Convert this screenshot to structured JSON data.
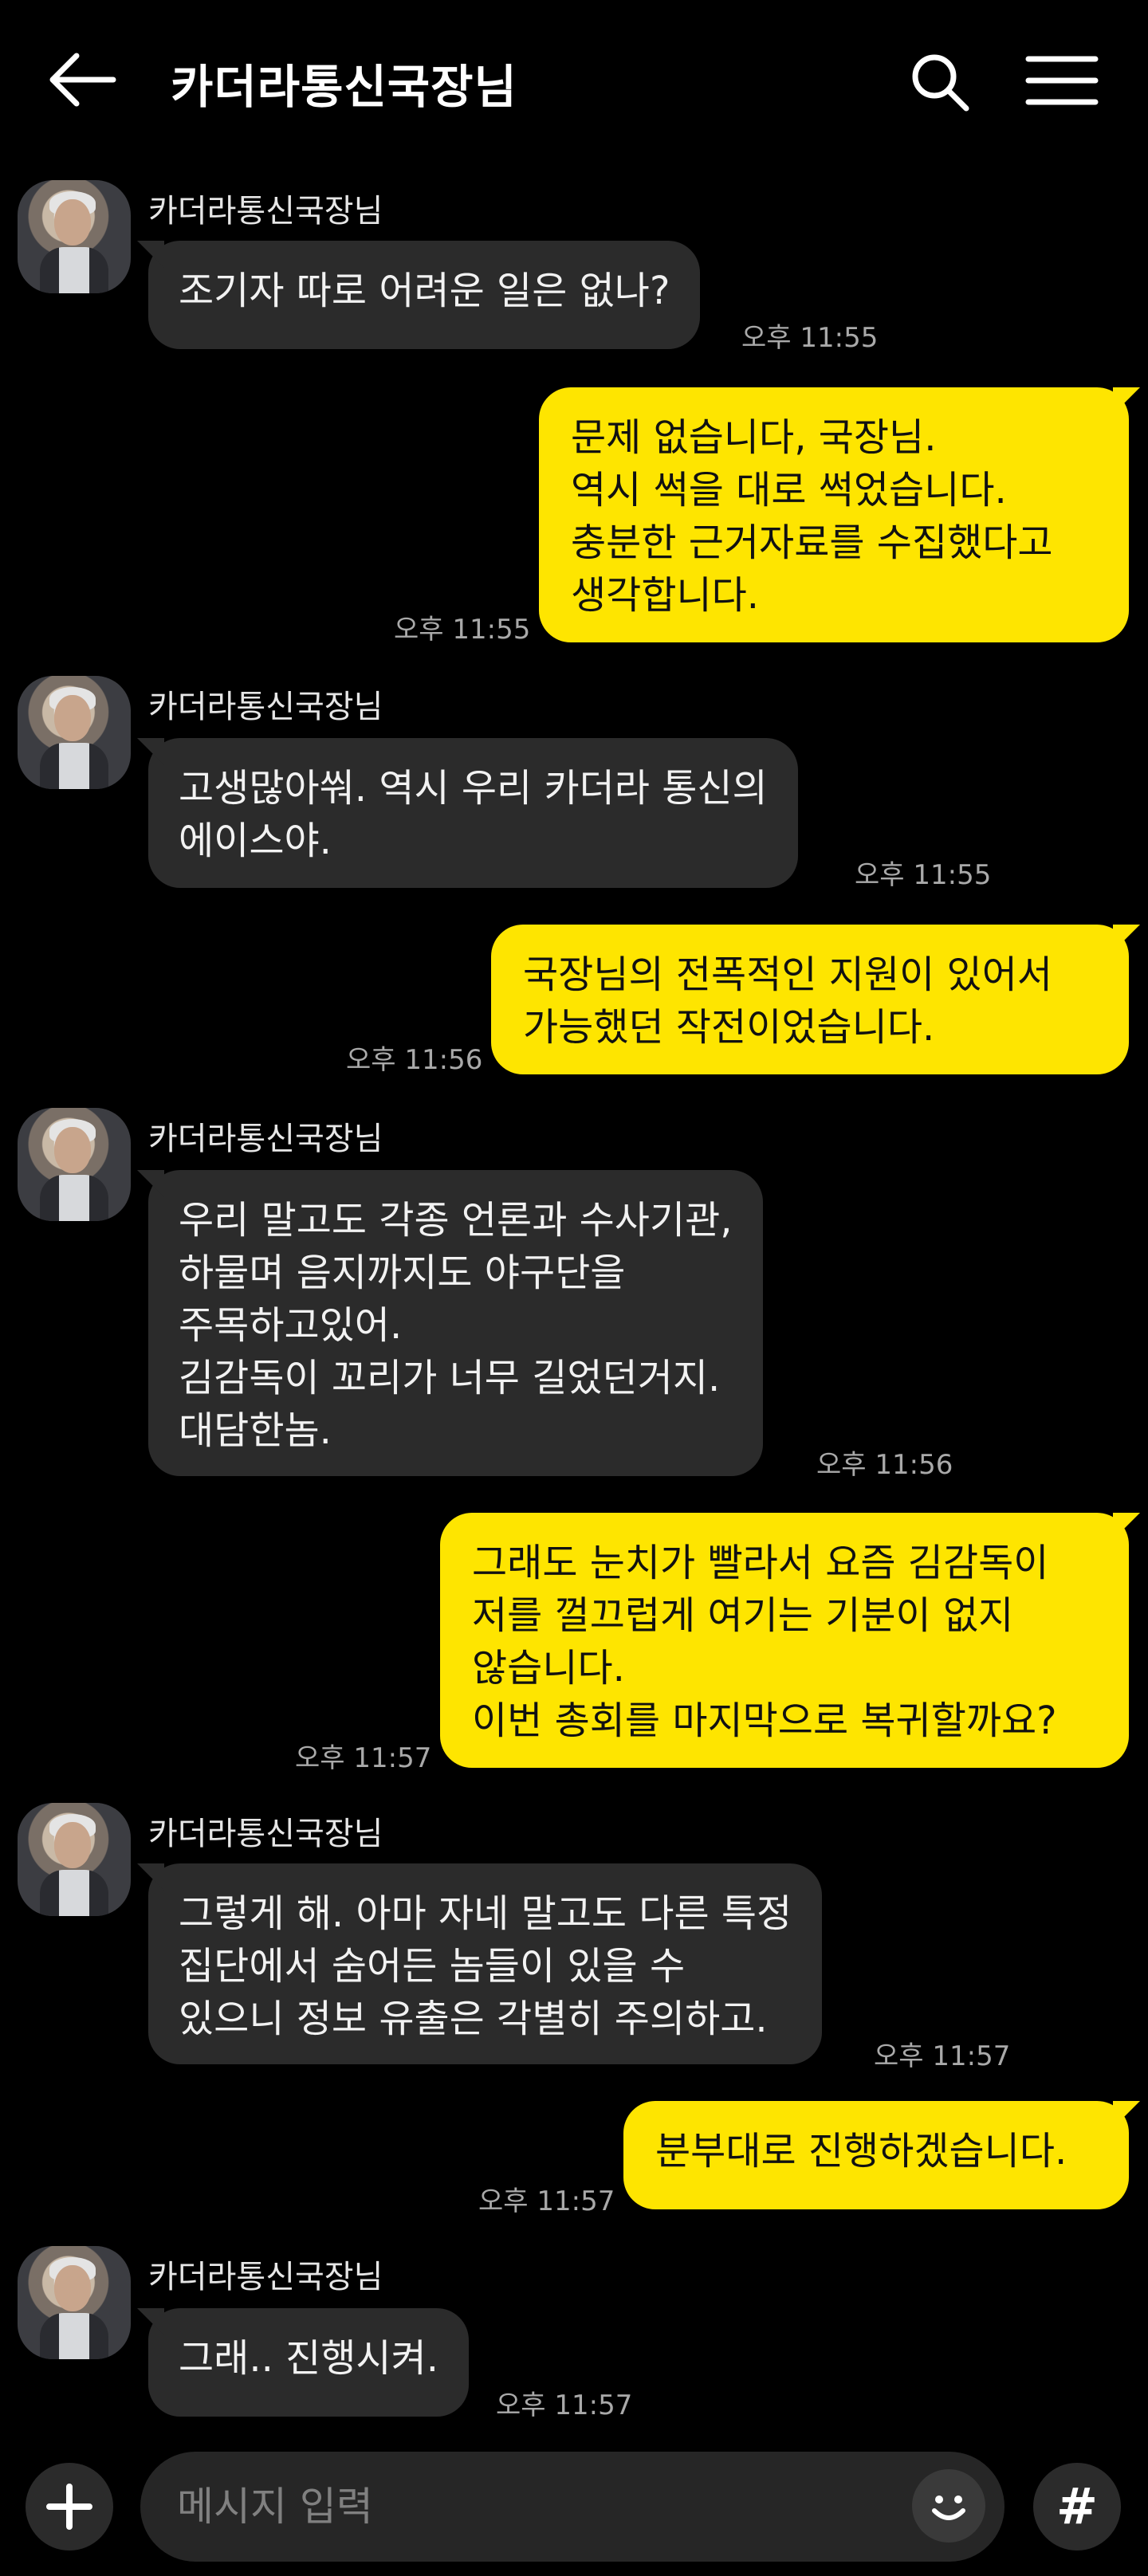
{
  "header": {
    "title": "카더라통신국장님",
    "back_icon": "arrow-left-icon",
    "search_icon": "search-icon",
    "menu_icon": "hamburger-menu-icon"
  },
  "messages": [
    {
      "side": "in",
      "sender": "카더라통신국장님",
      "text": "조기자 따로 어려운 일은 없나?",
      "time": "오후 11:55"
    },
    {
      "side": "out",
      "text": "문제 없습니다, 국장님.\n역시 썩을 대로 썩었습니다.\n충분한 근거자료를 수집했다고\n생각합니다.",
      "time": "오후 11:55"
    },
    {
      "side": "in",
      "sender": "카더라통신국장님",
      "text": "고생많아쒀. 역시 우리 카더라 통신의\n에이스야.",
      "time": "오후 11:55"
    },
    {
      "side": "out",
      "text": "국장님의 전폭적인 지원이 있어서\n가능했던 작전이었습니다.",
      "time": "오후 11:56"
    },
    {
      "side": "in",
      "sender": "카더라통신국장님",
      "text": "우리 말고도 각종 언론과 수사기관,\n하물며 음지까지도 야구단을\n주목하고있어.\n김감독이 꼬리가 너무 길었던거지.\n대담한놈.",
      "time": "오후 11:56"
    },
    {
      "side": "out",
      "text": "그래도 눈치가 빨라서 요즘 김감독이\n저를 껄끄럽게 여기는 기분이 없지\n않습니다.\n이번 총회를 마지막으로 복귀할까요?",
      "time": "오후 11:57"
    },
    {
      "side": "in",
      "sender": "카더라통신국장님",
      "text": "그렇게 해. 아마 자네 말고도 다른 특정\n집단에서 숨어든 놈들이 있을 수\n있으니 정보 유출은 각별히 주의하고.",
      "time": "오후 11:57"
    },
    {
      "side": "out",
      "text": "분부대로 진행하겠습니다.",
      "time": "오후 11:57"
    },
    {
      "side": "in",
      "sender": "카더라통신국장님",
      "text": "그래.. 진행시켜.",
      "time": "오후 11:57"
    }
  ],
  "composer": {
    "placeholder": "메시지 입력",
    "plus_icon": "plus-icon",
    "emoji_icon": "smiley-icon",
    "hash_label": "#"
  },
  "colors": {
    "background": "#000000",
    "incoming_bubble": "#2b2b2b",
    "outgoing_bubble": "#fee500",
    "timestamp": "#a9a9a9"
  }
}
